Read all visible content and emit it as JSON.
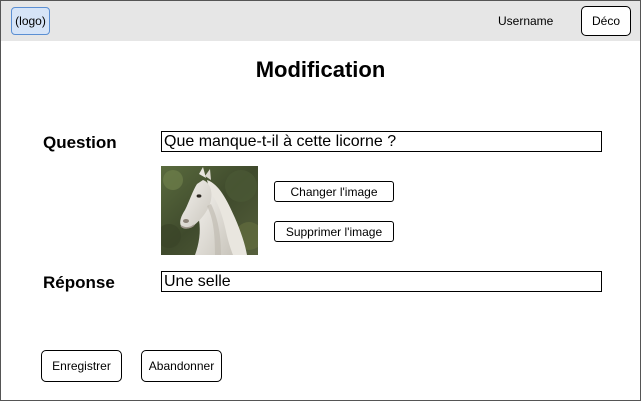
{
  "header": {
    "logo_label": "(logo)",
    "username": "Username",
    "logout_label": "Déco"
  },
  "page": {
    "title": "Modification"
  },
  "question": {
    "label": "Question",
    "value": "Que manque-t-il à cette licorne ?"
  },
  "image": {
    "change_label": "Changer l'image",
    "delete_label": "Supprimer l'image"
  },
  "answer": {
    "label": "Réponse",
    "value": "Une selle"
  },
  "actions": {
    "save_label": "Enregistrer",
    "cancel_label": "Abandonner"
  }
}
